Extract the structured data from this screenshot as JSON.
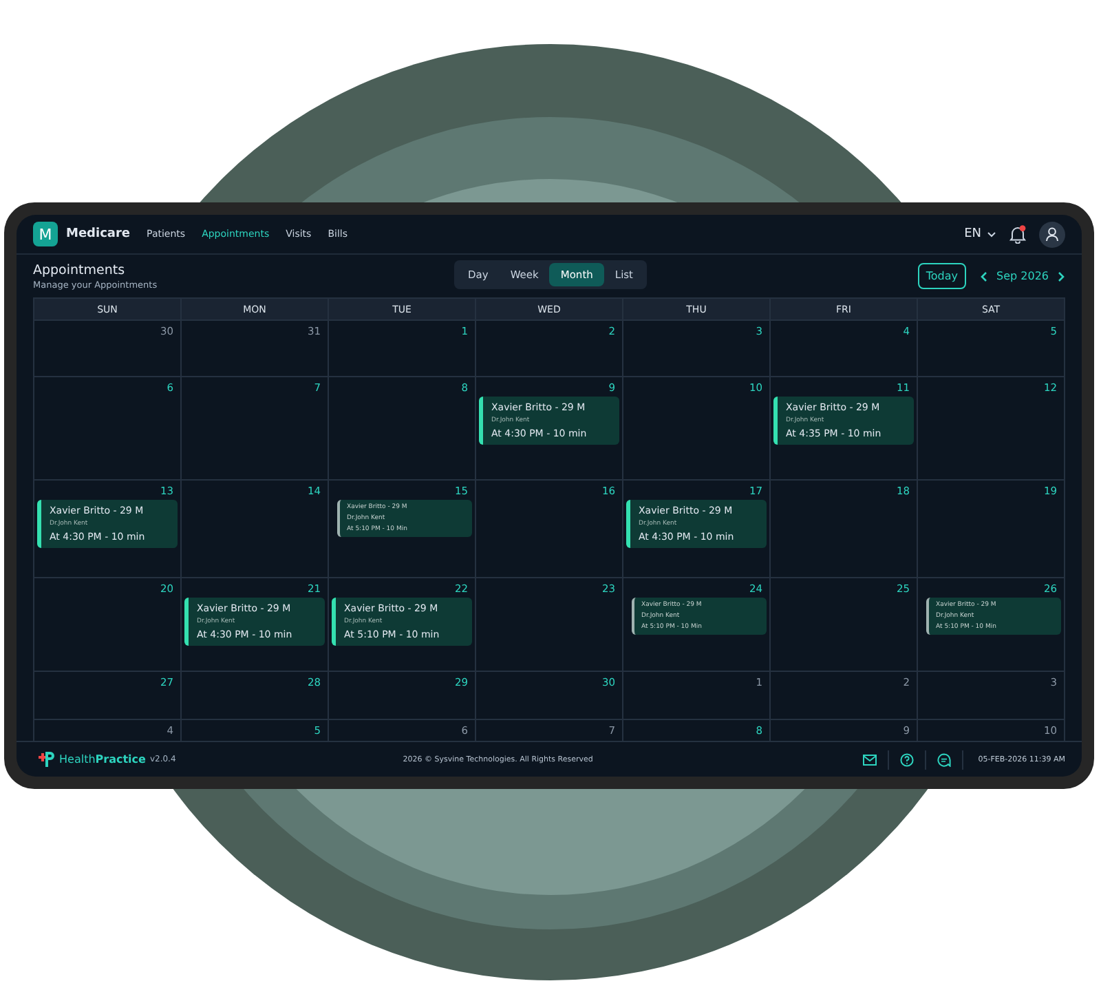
{
  "app": {
    "logo_letter": "M",
    "name": "Medicare"
  },
  "nav": [
    {
      "label": "Patients",
      "selected": false
    },
    {
      "label": "Appointments",
      "selected": true
    },
    {
      "label": "Visits",
      "selected": false
    },
    {
      "label": "Bills",
      "selected": false
    }
  ],
  "language": "EN",
  "notifications_unread": true,
  "page": {
    "title": "Appointments",
    "subtitle": "Manage your Appointments"
  },
  "views": [
    {
      "label": "Day",
      "selected": false
    },
    {
      "label": "Week",
      "selected": false
    },
    {
      "label": "Month",
      "selected": true
    },
    {
      "label": "List",
      "selected": false
    }
  ],
  "today_button": "Today",
  "month_label": "Sep 2026",
  "weekdays": [
    "SUN",
    "MON",
    "TUE",
    "WED",
    "THU",
    "FRI",
    "SAT"
  ],
  "weeks": [
    {
      "days": [
        {
          "day": "30",
          "in_month": false
        },
        {
          "day": "31",
          "in_month": false
        },
        {
          "day": "1",
          "in_month": true
        },
        {
          "day": "2",
          "in_month": true
        },
        {
          "day": "3",
          "in_month": true
        },
        {
          "day": "4",
          "in_month": true
        },
        {
          "day": "5",
          "in_month": true
        }
      ]
    },
    {
      "days": [
        {
          "day": "6",
          "in_month": true
        },
        {
          "day": "7",
          "in_month": true
        },
        {
          "day": "8",
          "in_month": true
        },
        {
          "day": "9",
          "in_month": true,
          "events": [
            {
              "kind": "large",
              "patient": "Xavier Britto - 29 M",
              "doctor": "Dr.John Kent",
              "time": "At 4:30 PM - 10 min"
            }
          ]
        },
        {
          "day": "10",
          "in_month": true
        },
        {
          "day": "11",
          "in_month": true,
          "events": [
            {
              "kind": "large",
              "patient": "Xavier Britto - 29 M",
              "doctor": "Dr.John Kent",
              "time": "At 4:35 PM - 10 min"
            }
          ]
        },
        {
          "day": "12",
          "in_month": true
        }
      ]
    },
    {
      "days": [
        {
          "day": "13",
          "in_month": true,
          "events": [
            {
              "kind": "large",
              "patient": "Xavier Britto - 29 M",
              "doctor": "Dr.John Kent",
              "time": "At 4:30 PM - 10 min"
            }
          ]
        },
        {
          "day": "14",
          "in_month": true
        },
        {
          "day": "15",
          "in_month": true,
          "events": [
            {
              "kind": "compact",
              "patient": "Xavier Britto - 29 M",
              "doctor": "Dr.John Kent",
              "time": "At 5:10 PM - 10 Min"
            }
          ]
        },
        {
          "day": "16",
          "in_month": true
        },
        {
          "day": "17",
          "in_month": true,
          "events": [
            {
              "kind": "large",
              "patient": "Xavier Britto - 29 M",
              "doctor": "Dr.John Kent",
              "time": "At 4:30 PM - 10 min"
            }
          ]
        },
        {
          "day": "18",
          "in_month": true
        },
        {
          "day": "19",
          "in_month": true
        }
      ]
    },
    {
      "days": [
        {
          "day": "20",
          "in_month": true
        },
        {
          "day": "21",
          "in_month": true,
          "events": [
            {
              "kind": "large",
              "patient": "Xavier Britto - 29 M",
              "doctor": "Dr.John Kent",
              "time": "At 4:30 PM - 10 min"
            }
          ]
        },
        {
          "day": "22",
          "in_month": true,
          "events": [
            {
              "kind": "large",
              "patient": "Xavier Britto - 29 M",
              "doctor": "Dr.John Kent",
              "time": "At 5:10 PM - 10 min"
            }
          ]
        },
        {
          "day": "23",
          "in_month": true
        },
        {
          "day": "24",
          "in_month": true,
          "events": [
            {
              "kind": "compact",
              "patient": "Xavier Britto - 29 M",
              "doctor": "Dr.John Kent",
              "time": "At 5:10 PM - 10 Min"
            }
          ]
        },
        {
          "day": "25",
          "in_month": true
        },
        {
          "day": "26",
          "in_month": true,
          "events": [
            {
              "kind": "compact",
              "patient": "Xavier Britto - 29 M",
              "doctor": "Dr.John Kent",
              "time": "At 5:10 PM - 10 Min"
            }
          ]
        }
      ]
    },
    {
      "days": [
        {
          "day": "27",
          "in_month": true
        },
        {
          "day": "28",
          "in_month": true
        },
        {
          "day": "29",
          "in_month": true
        },
        {
          "day": "30",
          "in_month": true
        },
        {
          "day": "1",
          "in_month": false
        },
        {
          "day": "2",
          "in_month": false
        },
        {
          "day": "3",
          "in_month": false
        }
      ]
    },
    {
      "days": [
        {
          "day": "4",
          "in_month": false
        },
        {
          "day": "5",
          "in_month": true
        },
        {
          "day": "6",
          "in_month": false
        },
        {
          "day": "7",
          "in_month": false
        },
        {
          "day": "8",
          "in_month": true
        },
        {
          "day": "9",
          "in_month": false
        },
        {
          "day": "10",
          "in_month": false
        }
      ]
    }
  ],
  "footer": {
    "brand": "Health**Practice**",
    "version": "v2.0.4",
    "copyright": "2026 © Sysvine Technologies. All Rights Reserved",
    "datetime": "05-FEB-2026 11:39 AM"
  }
}
